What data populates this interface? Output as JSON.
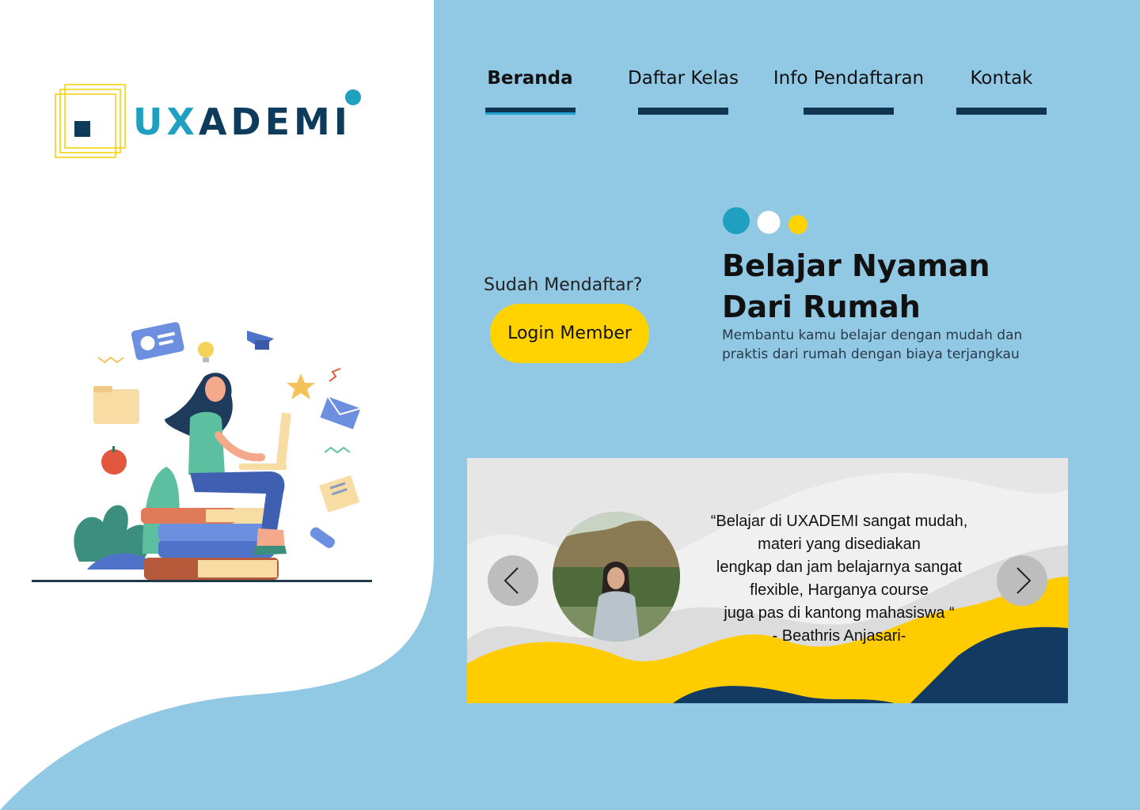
{
  "brand": {
    "logo_prefix": "UX",
    "logo_rest": "ADEMI"
  },
  "nav": [
    {
      "label": "Beranda",
      "active": true
    },
    {
      "label": "Daftar Kelas",
      "active": false
    },
    {
      "label": "Info Pendaftaran",
      "active": false
    },
    {
      "label": "Kontak",
      "active": false
    }
  ],
  "login": {
    "question": "Sudah Mendaftar?",
    "button_label": "Login Member"
  },
  "hero": {
    "title_line1": "Belajar Nyaman",
    "title_line2": "Dari Rumah",
    "subtitle_line1": "Membantu kamu belajar dengan mudah dan",
    "subtitle_line2": "praktis dari rumah dengan biaya terjangkau"
  },
  "testimonial": {
    "lines": [
      "“Belajar di UXADEMI sangat mudah,",
      "materi yang disediakan",
      "lengkap dan jam belajarnya sangat",
      "flexible, Harganya course",
      "juga pas di kantong mahasiswa “",
      "- Beathris Anjasari-"
    ]
  },
  "colors": {
    "background": "#91c8e4",
    "accent_yellow": "#ffd200",
    "accent_teal": "#1fa0c0",
    "navy": "#0d3b5c"
  },
  "icons": [
    "chevron-left-icon",
    "chevron-right-icon",
    "dot-teal-icon",
    "dot-white-icon",
    "dot-yellow-icon"
  ]
}
